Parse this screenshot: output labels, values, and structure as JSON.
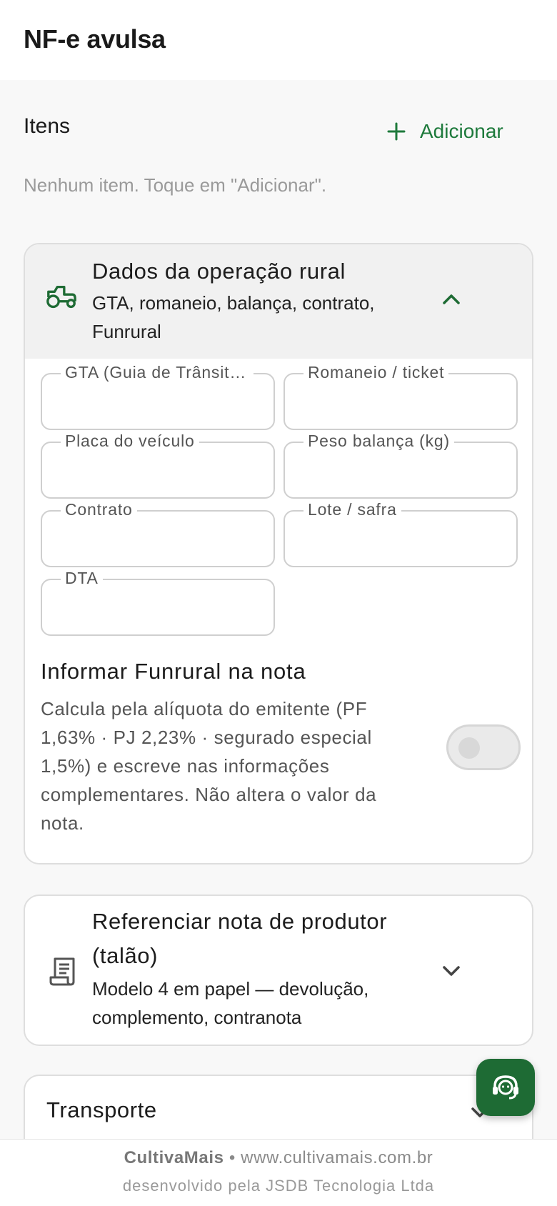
{
  "appbar": {
    "title": "NF-e avulsa"
  },
  "items": {
    "title": "Itens",
    "add_label": "Adicionar",
    "empty_hint": "Nenhum item. Toque em \"Adicionar\"."
  },
  "rural": {
    "title": "Dados da operação rural",
    "subtitle": "GTA, romaneio, balança, contrato, Funrural",
    "fields": {
      "gta": "GTA (Guia de Trânsito Animal)",
      "romaneio": "Romaneio / ticket",
      "placa": "Placa do veículo",
      "peso": "Peso balança (kg)",
      "contrato": "Contrato",
      "lote": "Lote / safra",
      "dta": "DTA"
    },
    "funrural": {
      "title": "Informar Funrural na nota",
      "description": "Calcula pela alíquota do emitente (PF 1,63% · PJ 2,23% · segurado especial 1,5%) e escreve nas informações complementares. Não altera o valor da nota.",
      "enabled": false
    }
  },
  "referencia": {
    "title": "Referenciar nota de produtor (talão)",
    "subtitle": "Modelo 4 em papel — devolução, complemento, contranota"
  },
  "transporte": {
    "title": "Transporte"
  },
  "footer": {
    "brand": "CultivaMais",
    "separator": "•",
    "url": "www.cultivamais.com.br",
    "credit": "desenvolvido pela JSDB Tecnologia Ltda"
  },
  "colors": {
    "accent": "#1e7a3c",
    "fab": "#1e6b34"
  },
  "icons": [
    "plus-icon",
    "tractor-icon",
    "chevron-up-icon",
    "receipt-icon",
    "chevron-down-icon",
    "support-agent-icon"
  ]
}
